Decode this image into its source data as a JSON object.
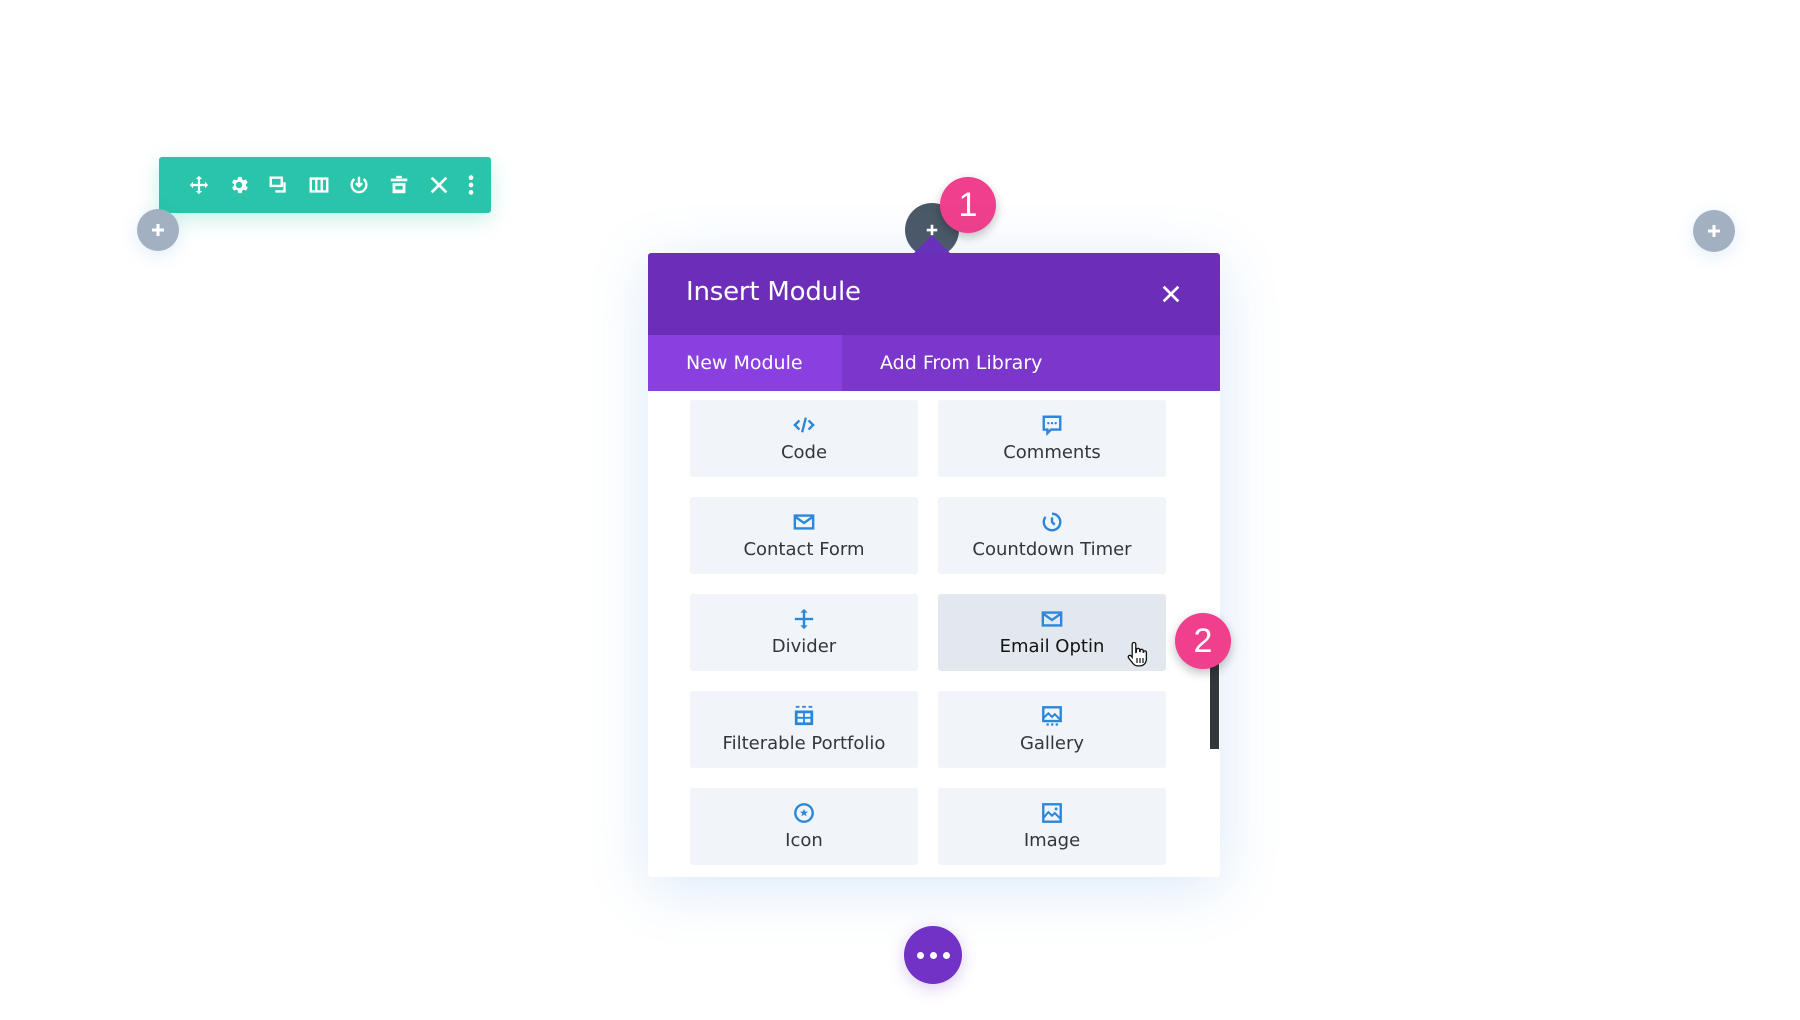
{
  "toolbar": {
    "color": "#29c4a9",
    "icons": [
      "move-icon",
      "gear-icon",
      "duplicate-icon",
      "columns-icon",
      "save-to-library-icon",
      "trash-icon",
      "close-icon",
      "more-icon"
    ]
  },
  "add_buttons": {
    "left": "+",
    "right": "+"
  },
  "annotations": {
    "badge_1": "1",
    "badge_2": "2",
    "badge_color": "#f03f8c"
  },
  "modal": {
    "title": "Insert Module",
    "header_color": "#6c2eb9",
    "tabs": [
      {
        "label": "New Module",
        "active": true
      },
      {
        "label": "Add From Library",
        "active": false
      }
    ],
    "modules": [
      {
        "label": "Code",
        "icon": "code-icon"
      },
      {
        "label": "Comments",
        "icon": "comments-icon"
      },
      {
        "label": "Contact Form",
        "icon": "envelope-icon"
      },
      {
        "label": "Countdown Timer",
        "icon": "timer-icon"
      },
      {
        "label": "Divider",
        "icon": "divider-icon"
      },
      {
        "label": "Email Optin",
        "icon": "envelope-icon",
        "hovered": true
      },
      {
        "label": "Filterable Portfolio",
        "icon": "portfolio-grid-icon"
      },
      {
        "label": "Gallery",
        "icon": "gallery-icon"
      },
      {
        "label": "Icon",
        "icon": "star-circle-icon"
      },
      {
        "label": "Image",
        "icon": "image-icon"
      }
    ],
    "icon_color": "#2b87da"
  },
  "footer": {
    "more_button_color": "#7232c6"
  }
}
